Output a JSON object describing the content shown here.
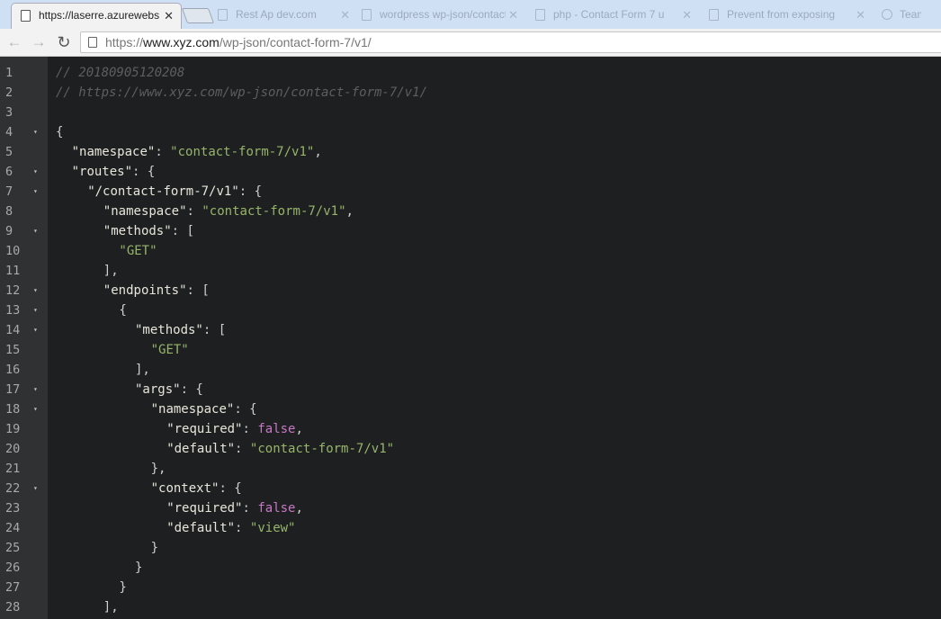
{
  "browser": {
    "tabs": [
      {
        "label": "https://laserre.azurewebs",
        "active": true,
        "icon": "page-icon"
      },
      {
        "label": "Rest Ap dev.com",
        "active": false,
        "icon": "page-icon"
      },
      {
        "label": "wordpress wp-json/contact",
        "active": false,
        "icon": "page-icon"
      },
      {
        "label": "php - Contact Form 7 u",
        "active": false,
        "icon": "page-icon"
      },
      {
        "label": "Prevent from exposing",
        "active": false,
        "icon": "page-icon"
      },
      {
        "label": "Team",
        "active": false,
        "icon": "globe-icon"
      }
    ],
    "close_glyph": "✕",
    "back_glyph": "←",
    "forward_glyph": "→",
    "reload_glyph": "↻",
    "url": {
      "scheme": "https://",
      "host": "www.xyz.com",
      "path": "/wp-json/contact-form-7/v1/"
    }
  },
  "editor": {
    "colors": {
      "background": "#1d1f21",
      "gutter": "#2f3133",
      "comment": "#5c5f60",
      "key": "#e8e6da",
      "string": "#97b56a",
      "boolean": "#c778c4",
      "punctuation": "#cfcfcf"
    },
    "fold_glyph": "▾",
    "lines": [
      {
        "n": "1",
        "fold": false,
        "indent": 0,
        "tokens": [
          {
            "t": "c",
            "v": "// 20180905120208"
          }
        ]
      },
      {
        "n": "2",
        "fold": false,
        "indent": 0,
        "tokens": [
          {
            "t": "c",
            "v": "// https://www.xyz.com/wp-json/contact-form-7/v1/"
          }
        ]
      },
      {
        "n": "3",
        "fold": false,
        "indent": 0,
        "tokens": []
      },
      {
        "n": "4",
        "fold": true,
        "indent": 0,
        "tokens": [
          {
            "t": "p",
            "v": "{"
          }
        ]
      },
      {
        "n": "5",
        "fold": false,
        "indent": 1,
        "tokens": [
          {
            "t": "k",
            "v": "\"namespace\""
          },
          {
            "t": "p",
            "v": ": "
          },
          {
            "t": "s",
            "v": "\"contact-form-7/v1\""
          },
          {
            "t": "p",
            "v": ","
          }
        ]
      },
      {
        "n": "6",
        "fold": true,
        "indent": 1,
        "tokens": [
          {
            "t": "k",
            "v": "\"routes\""
          },
          {
            "t": "p",
            "v": ": {"
          }
        ]
      },
      {
        "n": "7",
        "fold": true,
        "indent": 2,
        "tokens": [
          {
            "t": "k",
            "v": "\"/contact-form-7/v1\""
          },
          {
            "t": "p",
            "v": ": {"
          }
        ]
      },
      {
        "n": "8",
        "fold": false,
        "indent": 3,
        "tokens": [
          {
            "t": "k",
            "v": "\"namespace\""
          },
          {
            "t": "p",
            "v": ": "
          },
          {
            "t": "s",
            "v": "\"contact-form-7/v1\""
          },
          {
            "t": "p",
            "v": ","
          }
        ]
      },
      {
        "n": "9",
        "fold": true,
        "indent": 3,
        "tokens": [
          {
            "t": "k",
            "v": "\"methods\""
          },
          {
            "t": "p",
            "v": ": ["
          }
        ]
      },
      {
        "n": "10",
        "fold": false,
        "indent": 4,
        "tokens": [
          {
            "t": "s",
            "v": "\"GET\""
          }
        ]
      },
      {
        "n": "11",
        "fold": false,
        "indent": 3,
        "tokens": [
          {
            "t": "p",
            "v": "],"
          }
        ]
      },
      {
        "n": "12",
        "fold": true,
        "indent": 3,
        "tokens": [
          {
            "t": "k",
            "v": "\"endpoints\""
          },
          {
            "t": "p",
            "v": ": ["
          }
        ]
      },
      {
        "n": "13",
        "fold": true,
        "indent": 4,
        "tokens": [
          {
            "t": "p",
            "v": "{"
          }
        ]
      },
      {
        "n": "14",
        "fold": true,
        "indent": 5,
        "tokens": [
          {
            "t": "k",
            "v": "\"methods\""
          },
          {
            "t": "p",
            "v": ": ["
          }
        ]
      },
      {
        "n": "15",
        "fold": false,
        "indent": 6,
        "tokens": [
          {
            "t": "s",
            "v": "\"GET\""
          }
        ]
      },
      {
        "n": "16",
        "fold": false,
        "indent": 5,
        "tokens": [
          {
            "t": "p",
            "v": "],"
          }
        ]
      },
      {
        "n": "17",
        "fold": true,
        "indent": 5,
        "tokens": [
          {
            "t": "k",
            "v": "\"args\""
          },
          {
            "t": "p",
            "v": ": {"
          }
        ]
      },
      {
        "n": "18",
        "fold": true,
        "indent": 6,
        "tokens": [
          {
            "t": "k",
            "v": "\"namespace\""
          },
          {
            "t": "p",
            "v": ": {"
          }
        ]
      },
      {
        "n": "19",
        "fold": false,
        "indent": 7,
        "tokens": [
          {
            "t": "k",
            "v": "\"required\""
          },
          {
            "t": "p",
            "v": ": "
          },
          {
            "t": "b",
            "v": "false"
          },
          {
            "t": "p",
            "v": ","
          }
        ]
      },
      {
        "n": "20",
        "fold": false,
        "indent": 7,
        "tokens": [
          {
            "t": "k",
            "v": "\"default\""
          },
          {
            "t": "p",
            "v": ": "
          },
          {
            "t": "s",
            "v": "\"contact-form-7/v1\""
          }
        ]
      },
      {
        "n": "21",
        "fold": false,
        "indent": 6,
        "tokens": [
          {
            "t": "p",
            "v": "},"
          }
        ]
      },
      {
        "n": "22",
        "fold": true,
        "indent": 6,
        "tokens": [
          {
            "t": "k",
            "v": "\"context\""
          },
          {
            "t": "p",
            "v": ": {"
          }
        ]
      },
      {
        "n": "23",
        "fold": false,
        "indent": 7,
        "tokens": [
          {
            "t": "k",
            "v": "\"required\""
          },
          {
            "t": "p",
            "v": ": "
          },
          {
            "t": "b",
            "v": "false"
          },
          {
            "t": "p",
            "v": ","
          }
        ]
      },
      {
        "n": "24",
        "fold": false,
        "indent": 7,
        "tokens": [
          {
            "t": "k",
            "v": "\"default\""
          },
          {
            "t": "p",
            "v": ": "
          },
          {
            "t": "s",
            "v": "\"view\""
          }
        ]
      },
      {
        "n": "25",
        "fold": false,
        "indent": 6,
        "tokens": [
          {
            "t": "p",
            "v": "}"
          }
        ]
      },
      {
        "n": "26",
        "fold": false,
        "indent": 5,
        "tokens": [
          {
            "t": "p",
            "v": "}"
          }
        ]
      },
      {
        "n": "27",
        "fold": false,
        "indent": 4,
        "tokens": [
          {
            "t": "p",
            "v": "}"
          }
        ]
      },
      {
        "n": "28",
        "fold": false,
        "indent": 3,
        "tokens": [
          {
            "t": "p",
            "v": "],"
          }
        ]
      }
    ]
  }
}
